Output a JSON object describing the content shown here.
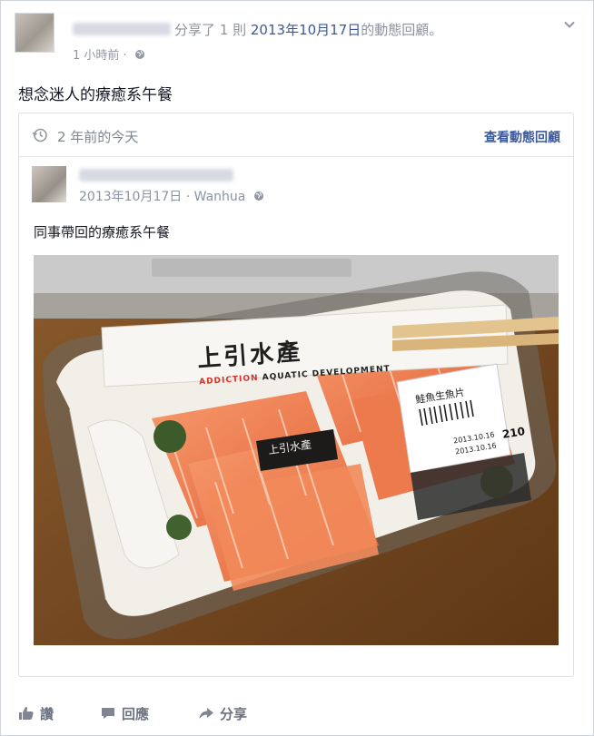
{
  "post": {
    "shared_verb": "分享了",
    "count_text": "1 則",
    "date_link": "2013年10月17日",
    "suffix": "的動態回顧。",
    "time": "1 小時前",
    "separator": "·",
    "status_text": "想念迷人的療癒系午餐"
  },
  "memory": {
    "years_ago": "2 年前的今天",
    "see_memories": "查看動態回顧",
    "date": "2013年10月17日",
    "separator": "·",
    "place": "Wanhua",
    "text": "同事帶回的療癒系午餐",
    "photo": {
      "brand_chinese": "上引水產",
      "brand_english_red": "ADDICTION",
      "brand_english": "AQUATIC DEVELOPMENT",
      "label_title": "鮭魚生魚片",
      "label_date_1": "2013.10.16",
      "label_date_2": "2013.10.16",
      "label_price": "210"
    }
  },
  "actions": {
    "like": "讚",
    "comment": "回應",
    "share": "分享"
  },
  "colors": {
    "link": "#3b5998",
    "muted": "#9197a3",
    "salmon": "#f07a4e"
  }
}
